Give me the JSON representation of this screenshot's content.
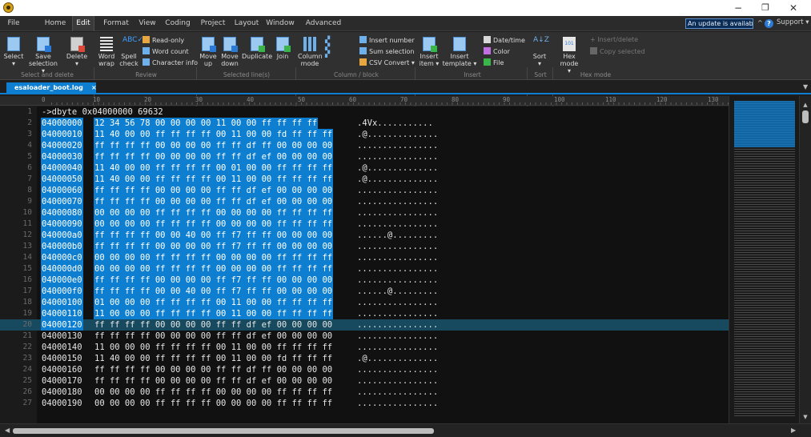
{
  "menu": {
    "tabs": [
      "File",
      "Home",
      "Edit",
      "Format",
      "View",
      "Coding",
      "Project",
      "Layout",
      "Window",
      "Advanced"
    ],
    "update_banner": "An update is available...",
    "support": "Support"
  },
  "ribbon": {
    "select": "Select",
    "save_selection": [
      "Save",
      "selection"
    ],
    "delete": "Delete",
    "word_wrap": [
      "Word",
      "wrap"
    ],
    "spell_check": [
      "Spell",
      "check"
    ],
    "read_only": "Read-only",
    "word_count": "Word count",
    "character_info": "Character info",
    "move_up": [
      "Move",
      "up"
    ],
    "move_down": [
      "Move",
      "down"
    ],
    "duplicate": "Duplicate",
    "join": "Join",
    "column_mode": [
      "Column",
      "mode"
    ],
    "insert_number": "Insert number",
    "sum_selection": "Sum selection",
    "csv_convert": "CSV Convert",
    "insert_item": [
      "Insert",
      "item"
    ],
    "insert_template": [
      "Insert",
      "template"
    ],
    "date_time": "Date/time",
    "color": "Color",
    "file": "File",
    "sort": "Sort",
    "hex_mode": [
      "Hex",
      "mode"
    ],
    "insert_delete": "Insert/delete",
    "copy_selected": "Copy selected",
    "groups": {
      "select_and_delete": "Select and delete",
      "review": "Review",
      "selected_lines": "Selected line(s)",
      "column_block": "Column / block",
      "insert": "Insert",
      "sort": "Sort",
      "hex_mode": "Hex mode"
    }
  },
  "file_tab": {
    "name": "esaloader_boot.log",
    "close": "×"
  },
  "ruler": [
    "0",
    "10",
    "20",
    "30",
    "40",
    "50",
    "60",
    "70",
    "80",
    "90",
    "100",
    "110",
    "120",
    "130"
  ],
  "editor": {
    "command_line": "->dbyte 0x04000000 69632",
    "rows": [
      {
        "addr": "04000000",
        "hex": "12 34 56 78 00 00 00 00 11 00 00 ff ff ff ff",
        "ascii": ".4Vx..........."
      },
      {
        "addr": "04000010",
        "hex": "11 40 00 00 ff ff ff ff 00 11 00 00 fd ff ff ff",
        "ascii": ".@.............."
      },
      {
        "addr": "04000020",
        "hex": "ff ff ff ff 00 00 00 00 ff ff df ff 00 00 00 00",
        "ascii": "................"
      },
      {
        "addr": "04000030",
        "hex": "ff ff ff ff 00 00 00 00 ff ff df ef 00 00 00 00",
        "ascii": "................"
      },
      {
        "addr": "04000040",
        "hex": "11 40 00 00 ff ff ff ff 00 01 00 00 ff ff ff ff",
        "ascii": ".@.............."
      },
      {
        "addr": "04000050",
        "hex": "11 40 00 00 ff ff ff ff 00 11 00 00 ff ff ff ff",
        "ascii": ".@.............."
      },
      {
        "addr": "04000060",
        "hex": "ff ff ff ff 00 00 00 00 ff ff df ef 00 00 00 00",
        "ascii": "................"
      },
      {
        "addr": "04000070",
        "hex": "ff ff ff ff 00 00 00 00 ff ff df ef 00 00 00 00",
        "ascii": "................"
      },
      {
        "addr": "04000080",
        "hex": "00 00 00 00 ff ff ff ff 00 00 00 00 ff ff ff ff",
        "ascii": "................"
      },
      {
        "addr": "04000090",
        "hex": "00 00 00 00 ff ff ff ff 00 00 00 00 ff ff ff ff",
        "ascii": "................"
      },
      {
        "addr": "040000a0",
        "hex": "ff ff ff ff 00 00 40 00 ff f7 ff ff 00 00 00 00",
        "ascii": "......@........."
      },
      {
        "addr": "040000b0",
        "hex": "ff ff ff ff 00 00 00 00 ff f7 ff ff 00 00 00 00",
        "ascii": "................"
      },
      {
        "addr": "040000c0",
        "hex": "00 00 00 00 ff ff ff ff 00 00 00 00 ff ff ff ff",
        "ascii": "................"
      },
      {
        "addr": "040000d0",
        "hex": "00 00 00 00 ff ff ff ff 00 00 00 00 ff ff ff ff",
        "ascii": "................"
      },
      {
        "addr": "040000e0",
        "hex": "ff ff ff ff 00 00 00 00 ff f7 ff ff 00 00 00 00",
        "ascii": "................"
      },
      {
        "addr": "040000f0",
        "hex": "ff ff ff ff 00 00 40 00 ff f7 ff ff 00 00 00 00",
        "ascii": "......@........."
      },
      {
        "addr": "04000100",
        "hex": "01 00 00 00 ff ff ff ff 00 11 00 00 ff ff ff ff",
        "ascii": "................"
      },
      {
        "addr": "04000110",
        "hex": "11 00 00 00 ff ff ff ff 00 11 00 00 ff ff ff ff",
        "ascii": "................"
      },
      {
        "addr": "04000120",
        "hex": "ff ff ff ff 00 00 00 00 ff ff df ef 00 00 00 00",
        "ascii": "................"
      },
      {
        "addr": "04000130",
        "hex": "ff ff ff ff 00 00 00 00 ff ff df ef 00 00 00 00",
        "ascii": "................"
      },
      {
        "addr": "04000140",
        "hex": "11 00 00 00 ff ff ff ff 00 11 00 00 ff ff ff ff",
        "ascii": "................"
      },
      {
        "addr": "04000150",
        "hex": "11 40 00 00 ff ff ff ff 00 11 00 00 fd ff ff ff",
        "ascii": ".@.............."
      },
      {
        "addr": "04000160",
        "hex": "ff ff ff ff 00 00 00 00 ff ff df ff 00 00 00 00",
        "ascii": "................"
      },
      {
        "addr": "04000170",
        "hex": "ff ff ff ff 00 00 00 00 ff ff df ef 00 00 00 00",
        "ascii": "................"
      },
      {
        "addr": "04000180",
        "hex": "00 00 00 00 ff ff ff ff 00 00 00 00 ff ff ff ff",
        "ascii": "................"
      },
      {
        "addr": "04000190",
        "hex": "00 00 00 00 ff ff ff ff 00 00 00 00 ff ff ff ff",
        "ascii": "................"
      }
    ],
    "selected_rows_through": 19,
    "current_line": 20
  },
  "colors": {
    "accent": "#0e7fd0",
    "current_line": "#174a5f",
    "background": "#111111"
  }
}
